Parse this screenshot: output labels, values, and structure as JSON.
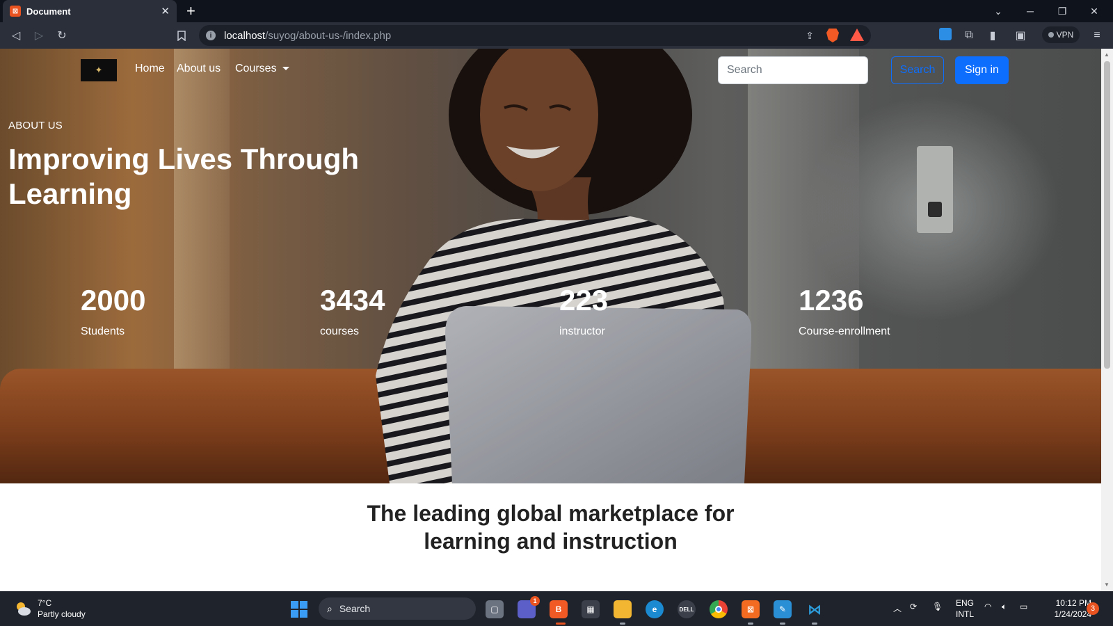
{
  "browser": {
    "tab_title": "Document",
    "tab_favicon": "xampp-icon",
    "url_host": "localhost",
    "url_path": "/suyog/about-us-/index.php",
    "vpn_label": "VPN"
  },
  "nav": {
    "links": [
      {
        "label": "Home"
      },
      {
        "label": "About us"
      },
      {
        "label": "Courses"
      }
    ],
    "search_placeholder": "Search",
    "search_button": "Search",
    "signin_button": "Sign in"
  },
  "hero": {
    "eyebrow": "ABOUT US",
    "headline": "Improving Lives Through Learning",
    "stats": [
      {
        "value": "2000",
        "label": "Students"
      },
      {
        "value": "3434",
        "label": "courses"
      },
      {
        "value": "223",
        "label": "instructor"
      },
      {
        "value": "1236",
        "label": "Course-enrollment"
      }
    ]
  },
  "tagline": {
    "line1": "The leading global marketplace for",
    "line2": "learning and instruction"
  },
  "taskbar": {
    "weather_temp": "7°C",
    "weather_desc": "Partly cloudy",
    "search_label": "Search",
    "lang_line1": "ENG",
    "lang_line2": "INTL",
    "time": "10:12 PM",
    "date": "1/24/2024",
    "notification_count": "3",
    "teams_badge": "1"
  },
  "colors": {
    "primary": "#0d6efd",
    "chrome_dark": "#0f131b",
    "chrome_toolbar": "#2a2f3a",
    "taskbar": "#1f232b"
  }
}
